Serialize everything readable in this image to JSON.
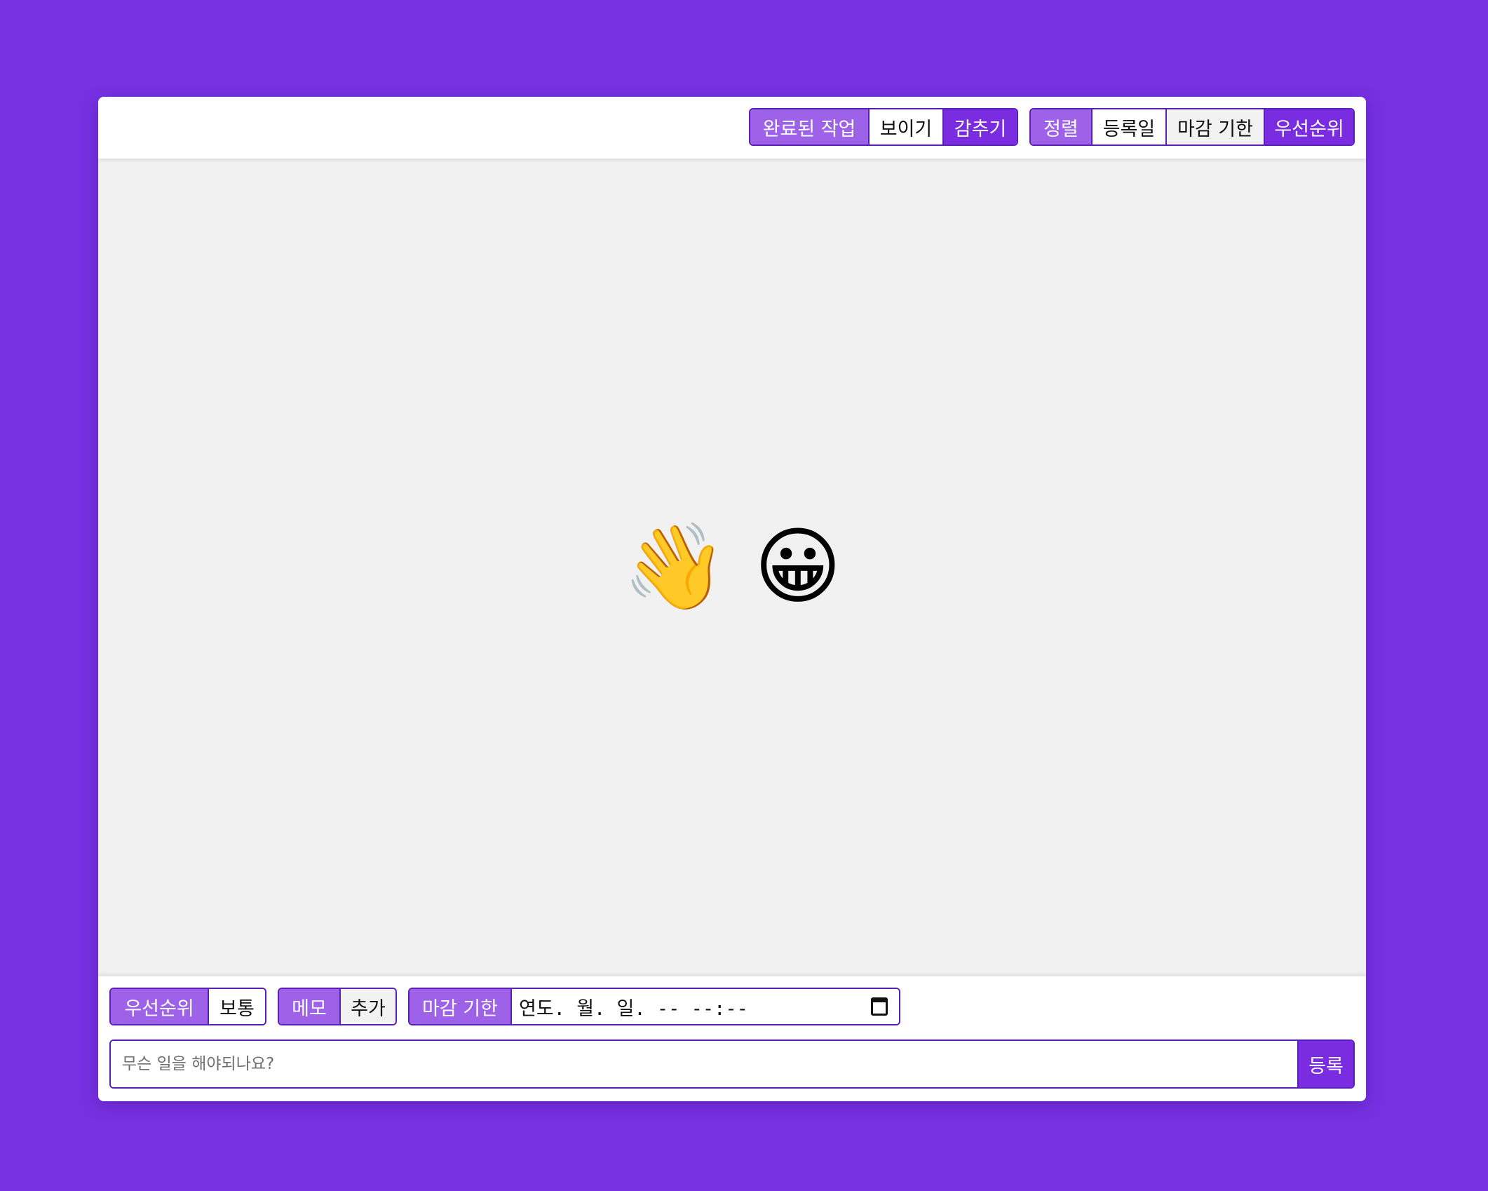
{
  "top_bar": {
    "completed_group": {
      "label": "완료된 작업",
      "show": "보이기",
      "hide": "감추기",
      "selected": "감추기"
    },
    "sort_group": {
      "label": "정렬",
      "by_created": "등록일",
      "by_deadline": "마감 기한",
      "by_priority": "우선순위",
      "selected": "우선순위"
    }
  },
  "empty_state": {
    "emoji": "👋 😀"
  },
  "bottom_bar": {
    "priority": {
      "label": "우선순위",
      "value": "보통"
    },
    "memo": {
      "label": "메모",
      "action": "추가"
    },
    "deadline": {
      "label": "마감 기한",
      "value": "연도. 월. 일. -- --:--",
      "icon": "calendar-icon"
    },
    "todo": {
      "placeholder": "무슨 일을 해야되나요?",
      "submit": "등록"
    }
  },
  "colors": {
    "background": "#7730e2",
    "accent": "#7a2de0",
    "label_bg": "#9d62e8",
    "border": "#5a1fb8"
  }
}
